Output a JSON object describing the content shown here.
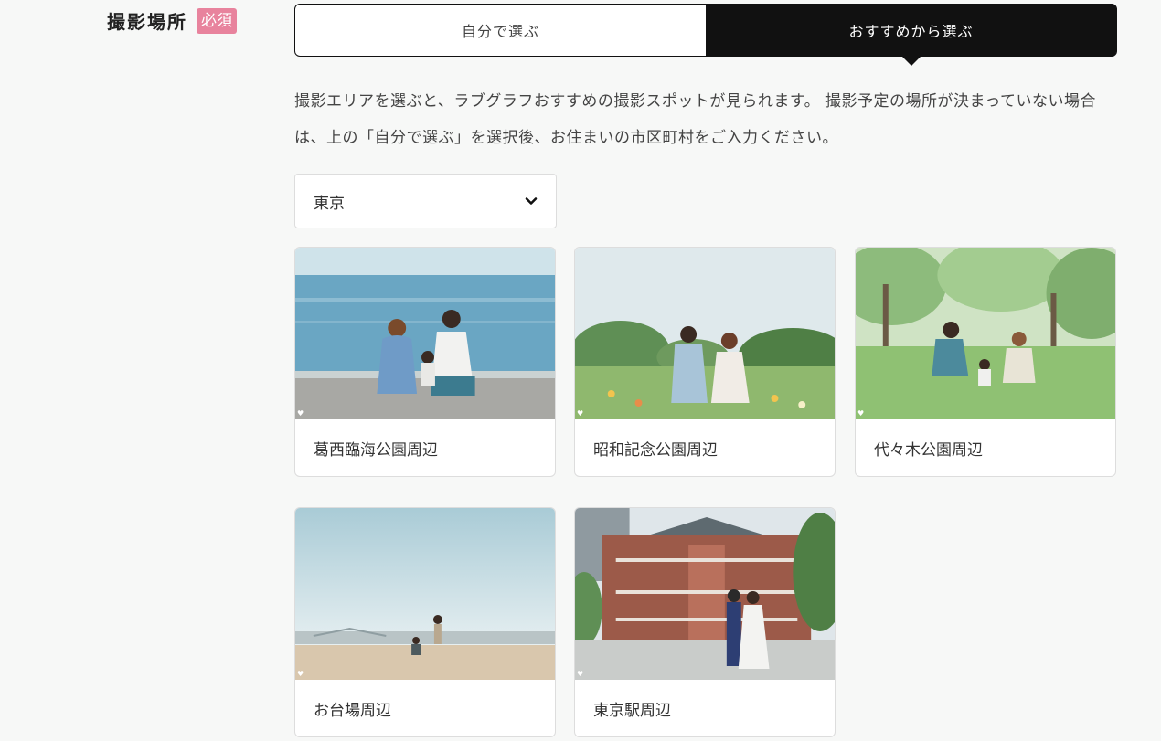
{
  "field": {
    "label": "撮影場所",
    "required_badge": "必須"
  },
  "tabs": {
    "self": "自分で選ぶ",
    "recommended": "おすすめから選ぶ",
    "active": "recommended"
  },
  "description": "撮影エリアを選ぶと、ラブグラフおすすめの撮影スポットが見られます。 撮影予定の場所が決まっていない場合は、上の「自分で選ぶ」を選択後、お住まいの市区町村をご入力ください。",
  "area_select": {
    "value": "東京",
    "icon": "chevron-down-icon"
  },
  "spots": [
    {
      "label": "葛西臨海公園周辺",
      "image": "family-on-beach-photo"
    },
    {
      "label": "昭和記念公園周辺",
      "image": "family-in-flower-field-photo"
    },
    {
      "label": "代々木公園周辺",
      "image": "family-on-park-lawn-photo"
    },
    {
      "label": "お台場周辺",
      "image": "couple-on-sand-photo"
    },
    {
      "label": "東京駅周辺",
      "image": "couple-at-station-photo"
    }
  ],
  "colors": {
    "accent_dark": "#111111",
    "required_badge": "#e8839d",
    "background": "#f7f8f7"
  }
}
